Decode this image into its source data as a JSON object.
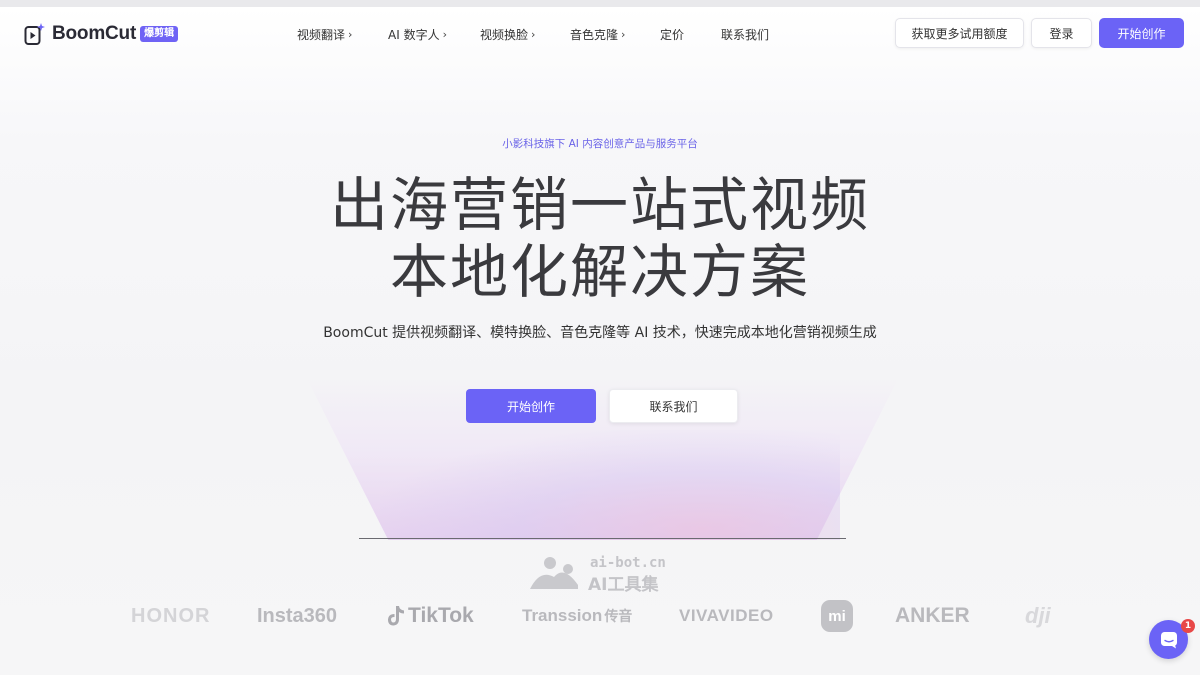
{
  "brand": {
    "name": "BoomCut",
    "badge": "爆剪辑",
    "accent": "#6b63f6"
  },
  "nav": {
    "menu": [
      {
        "label": "视频翻译",
        "has_arrow": true
      },
      {
        "label": "AI 数字人",
        "has_arrow": true
      },
      {
        "label": "视频换脸",
        "has_arrow": true
      },
      {
        "label": "音色克隆",
        "has_arrow": true
      },
      {
        "label": "定价",
        "has_arrow": false
      },
      {
        "label": "联系我们",
        "has_arrow": false
      }
    ],
    "arrow_glyph": "›",
    "trial_label": "获取更多试用额度",
    "login_label": "登录",
    "start_label": "开始创作"
  },
  "hero": {
    "eyebrow": "小影科技旗下 AI 内容创意产品与服务平台",
    "title_line1": "出海营销一站式视频",
    "title_line2": "本地化解决方案",
    "subtitle": "BoomCut 提供视频翻译、模特换脸、音色克隆等 AI 技术，快速完成本地化营销视频生成",
    "cta_primary": "开始创作",
    "cta_secondary": "联系我们"
  },
  "watermark": {
    "domain": "ai-bot.cn",
    "name": "AI工具集"
  },
  "partners": [
    {
      "name": "HONOR",
      "icon": "honor-logo"
    },
    {
      "name": "Insta360",
      "icon": "insta360-logo"
    },
    {
      "name": "TikTok",
      "icon": "tiktok-logo"
    },
    {
      "name": "Transsion",
      "suffix": "传音",
      "icon": "transsion-logo"
    },
    {
      "name": "VIVAVIDEO",
      "icon": "vivavideo-logo"
    },
    {
      "name": "mi",
      "icon": "xiaomi-logo"
    },
    {
      "name": "ANKER",
      "icon": "anker-logo"
    },
    {
      "name": "dji",
      "icon": "dji-logo"
    }
  ],
  "chat": {
    "unread": "1",
    "icon": "chat-bubble-icon"
  }
}
